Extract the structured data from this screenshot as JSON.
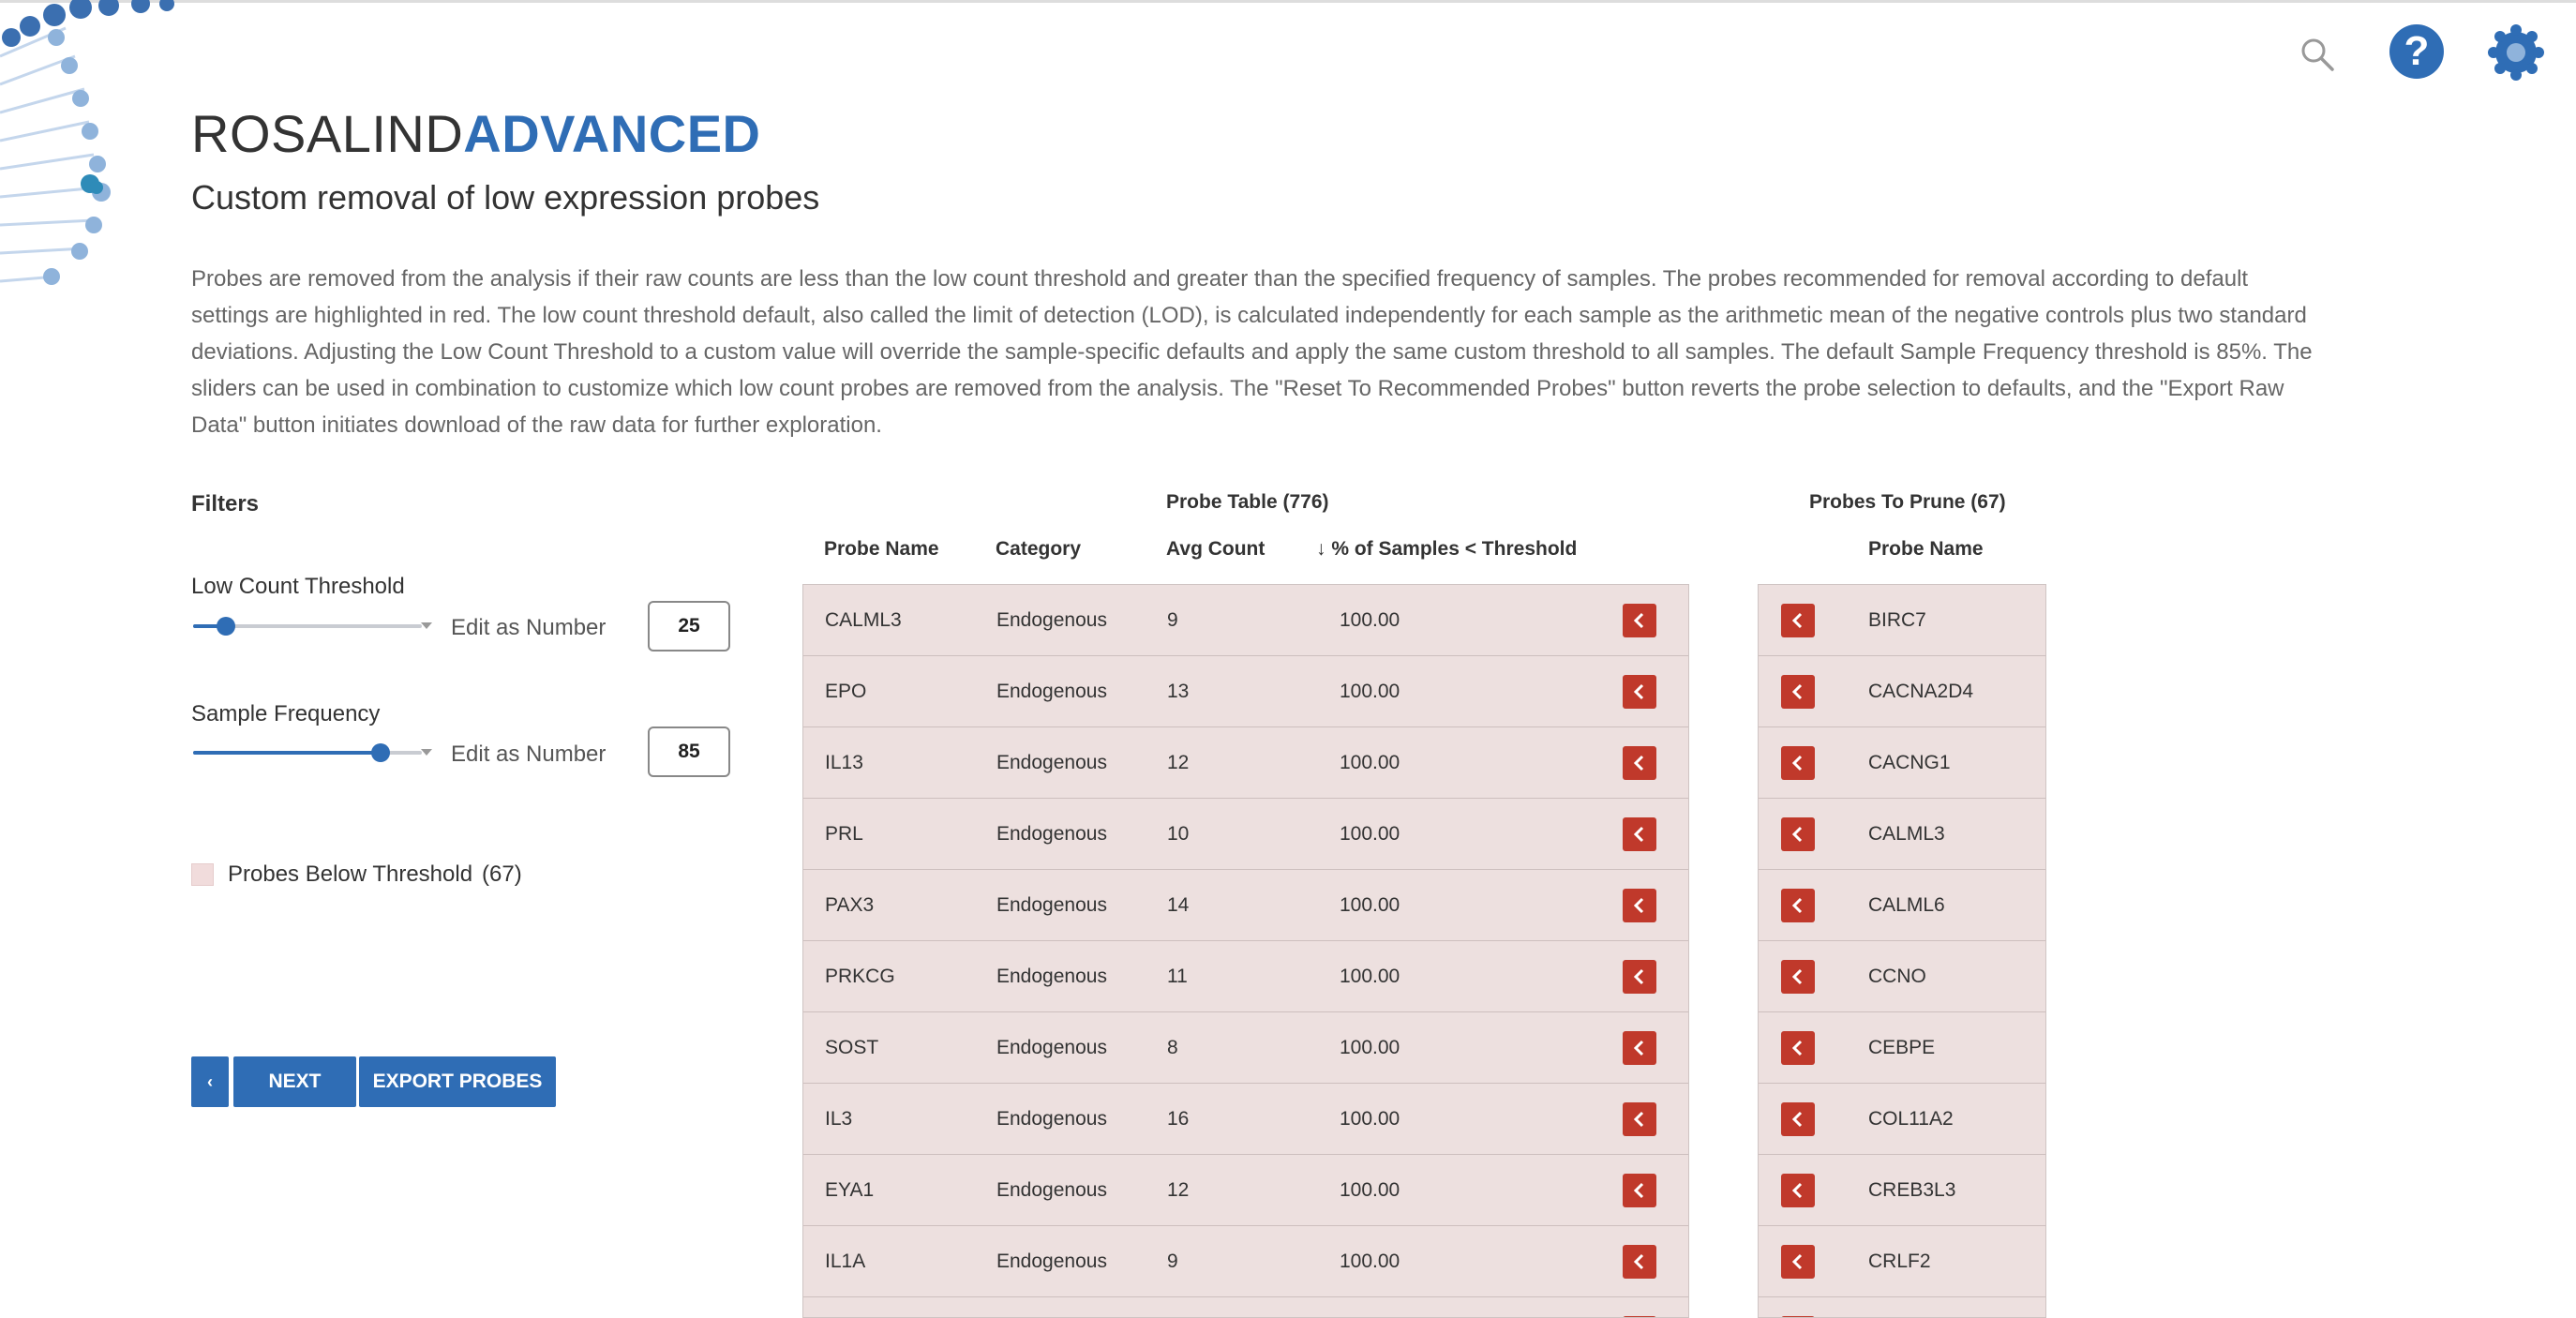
{
  "header": {
    "brand_plain": "ROSALIND",
    "brand_bold": "ADVANCED",
    "subtitle": "Custom removal of low expression probes",
    "description": "Probes are removed from the analysis if their raw counts are less than the low count threshold and greater than the specified frequency of samples. The probes recommended for removal according to default settings are highlighted in red. The low count threshold default, also called the limit of detection (LOD), is calculated independently for each sample as the arithmetic mean of the negative controls plus two standard deviations. Adjusting the Low Count Threshold to a custom value will override the sample-specific defaults and apply the same custom threshold to all samples. The default Sample Frequency threshold is 85%. The sliders can be used in combination to customize which low count probes are removed from the analysis. The \"Reset To Recommended Probes\" button reverts the probe selection to defaults, and the \"Export Raw Data\" button initiates download of the raw data for further exploration."
  },
  "icons": {
    "search": "search-icon",
    "help": "help-icon",
    "help_glyph": "?",
    "settings": "gear-icon"
  },
  "filters": {
    "title": "Filters",
    "low_count": {
      "label": "Low Count Threshold",
      "edit_label": "Edit as Number",
      "value": "25",
      "slider_fraction": 0.15
    },
    "sample_frequency": {
      "label": "Sample Frequency",
      "edit_label": "Edit as Number",
      "value": "85",
      "slider_fraction": 0.85
    },
    "legend": {
      "label": "Probes Below Threshold",
      "count": "(67)"
    }
  },
  "buttons": {
    "back": "‹",
    "next": "NEXT",
    "export": "EXPORT PROBES"
  },
  "probe_table": {
    "title": "Probe Table (776)",
    "columns": {
      "name": "Probe Name",
      "category": "Category",
      "avg": "Avg Count",
      "pct": "↓ % of Samples < Threshold"
    },
    "rows": [
      {
        "name": "CALML3",
        "category": "Endogenous",
        "avg": "9",
        "pct": "100.00"
      },
      {
        "name": "EPO",
        "category": "Endogenous",
        "avg": "13",
        "pct": "100.00"
      },
      {
        "name": "IL13",
        "category": "Endogenous",
        "avg": "12",
        "pct": "100.00"
      },
      {
        "name": "PRL",
        "category": "Endogenous",
        "avg": "10",
        "pct": "100.00"
      },
      {
        "name": "PAX3",
        "category": "Endogenous",
        "avg": "14",
        "pct": "100.00"
      },
      {
        "name": "PRKCG",
        "category": "Endogenous",
        "avg": "11",
        "pct": "100.00"
      },
      {
        "name": "SOST",
        "category": "Endogenous",
        "avg": "8",
        "pct": "100.00"
      },
      {
        "name": "IL3",
        "category": "Endogenous",
        "avg": "16",
        "pct": "100.00"
      },
      {
        "name": "EYA1",
        "category": "Endogenous",
        "avg": "12",
        "pct": "100.00"
      },
      {
        "name": "IL1A",
        "category": "Endogenous",
        "avg": "9",
        "pct": "100.00"
      }
    ]
  },
  "prune_table": {
    "title": "Probes To Prune (67)",
    "column": "Probe Name",
    "rows": [
      "BIRC7",
      "CACNA2D4",
      "CACNG1",
      "CALML3",
      "CALML6",
      "CCNO",
      "CEBPE",
      "COL11A2",
      "CREB3L3",
      "CRLF2"
    ]
  }
}
